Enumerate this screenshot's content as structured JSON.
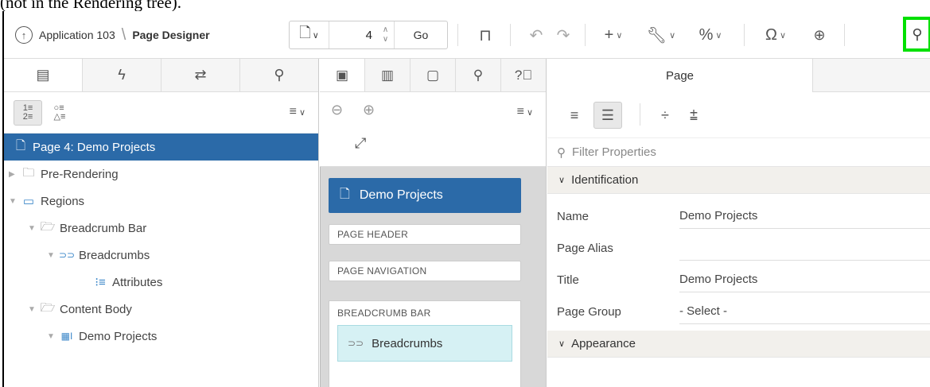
{
  "caption": "(not in the Rendering tree).",
  "toolbar": {
    "app_icon": "arrow-up-circle-icon",
    "app_label": "Application 103",
    "separator": "\\",
    "page_designer_label": "Page Designer",
    "page_number": "4",
    "go_label": "Go",
    "icons": [
      "unlock-icon",
      "undo-icon",
      "redo-icon",
      "add-menu-icon",
      "utilities-icon",
      "shared-components-icon",
      "team-development-icon",
      "comments-icon",
      "shapes-icon"
    ]
  },
  "left": {
    "tabs": [
      "rendering-tab",
      "dynamic-actions-tab",
      "processing-tab",
      "shared-components-tab"
    ],
    "tree": [
      {
        "label": "Page 4: Demo Projects",
        "selected": true
      },
      {
        "label": "Pre-Rendering"
      },
      {
        "label": "Regions"
      },
      {
        "label": "Breadcrumb Bar"
      },
      {
        "label": "Breadcrumbs"
      },
      {
        "label": "Attributes"
      },
      {
        "label": "Content Body"
      },
      {
        "label": "Demo Projects"
      }
    ]
  },
  "middle": {
    "page_title": "Demo Projects",
    "slots": [
      "PAGE HEADER",
      "PAGE NAVIGATION",
      "BREADCRUMB BAR"
    ],
    "breadcrumb_region": "Breadcrumbs"
  },
  "right": {
    "tab_label": "Page",
    "filter_placeholder": "Filter Properties",
    "sections": {
      "identification": "Identification",
      "appearance": "Appearance"
    },
    "props": [
      {
        "key": "Name",
        "value": "Demo Projects"
      },
      {
        "key": "Page Alias",
        "value": ""
      },
      {
        "key": "Title",
        "value": "Demo Projects"
      },
      {
        "key": "Page Group",
        "value": "- Select -"
      }
    ]
  },
  "colors": {
    "selected_bg": "#2b6aa8",
    "highlight": "#00e000",
    "region_bg": "#d6f1f4"
  }
}
